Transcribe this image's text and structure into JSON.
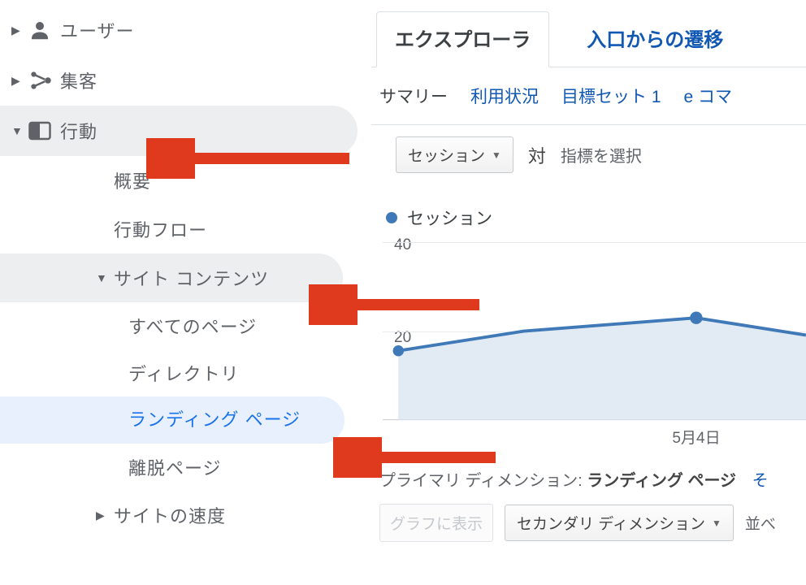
{
  "sidebar": {
    "items": [
      {
        "label": "ユーザー",
        "icon": "user-icon",
        "expanded": false
      },
      {
        "label": "集客",
        "icon": "acquisition-icon",
        "expanded": false
      },
      {
        "label": "行動",
        "icon": "behavior-icon",
        "expanded": true,
        "active": true
      }
    ],
    "behavior_children": [
      {
        "label": "概要"
      },
      {
        "label": "行動フロー"
      },
      {
        "label": "サイト コンテンツ",
        "expanded": true,
        "active": true
      },
      {
        "label": "サイトの速度",
        "expanded": false
      }
    ],
    "site_content_children": [
      {
        "label": "すべてのページ"
      },
      {
        "label": "ディレクトリ"
      },
      {
        "label": "ランディング ページ",
        "selected": true
      },
      {
        "label": "離脱ページ"
      }
    ]
  },
  "tabs": {
    "items": [
      {
        "label": "エクスプローラ",
        "active": true
      },
      {
        "label": "入口からの遷移"
      }
    ]
  },
  "subtabs": {
    "items": [
      {
        "label": "サマリー",
        "active": true
      },
      {
        "label": "利用状況"
      },
      {
        "label": "目標セット 1"
      },
      {
        "label": "e コマ"
      }
    ]
  },
  "controls": {
    "metric_dropdown": "セッション",
    "vs": "対",
    "choose_metric": "指標を選択"
  },
  "legend": {
    "series_name": "セッション"
  },
  "primary_dimension": {
    "label": "プライマリ ディメンション:",
    "value": "ランディング ページ",
    "other": "そ"
  },
  "secondary_controls": {
    "graph_button": "グラフに表示",
    "secondary_dim": "セカンダリ ディメンション",
    "sort": "並べ"
  },
  "chart_data": {
    "type": "line",
    "series": [
      {
        "name": "セッション",
        "values": [
          17,
          21,
          24,
          20
        ]
      }
    ],
    "x_ticks": [
      "5月4日"
    ],
    "y_ticks": [
      20,
      40
    ],
    "ylim": [
      0,
      40
    ]
  }
}
